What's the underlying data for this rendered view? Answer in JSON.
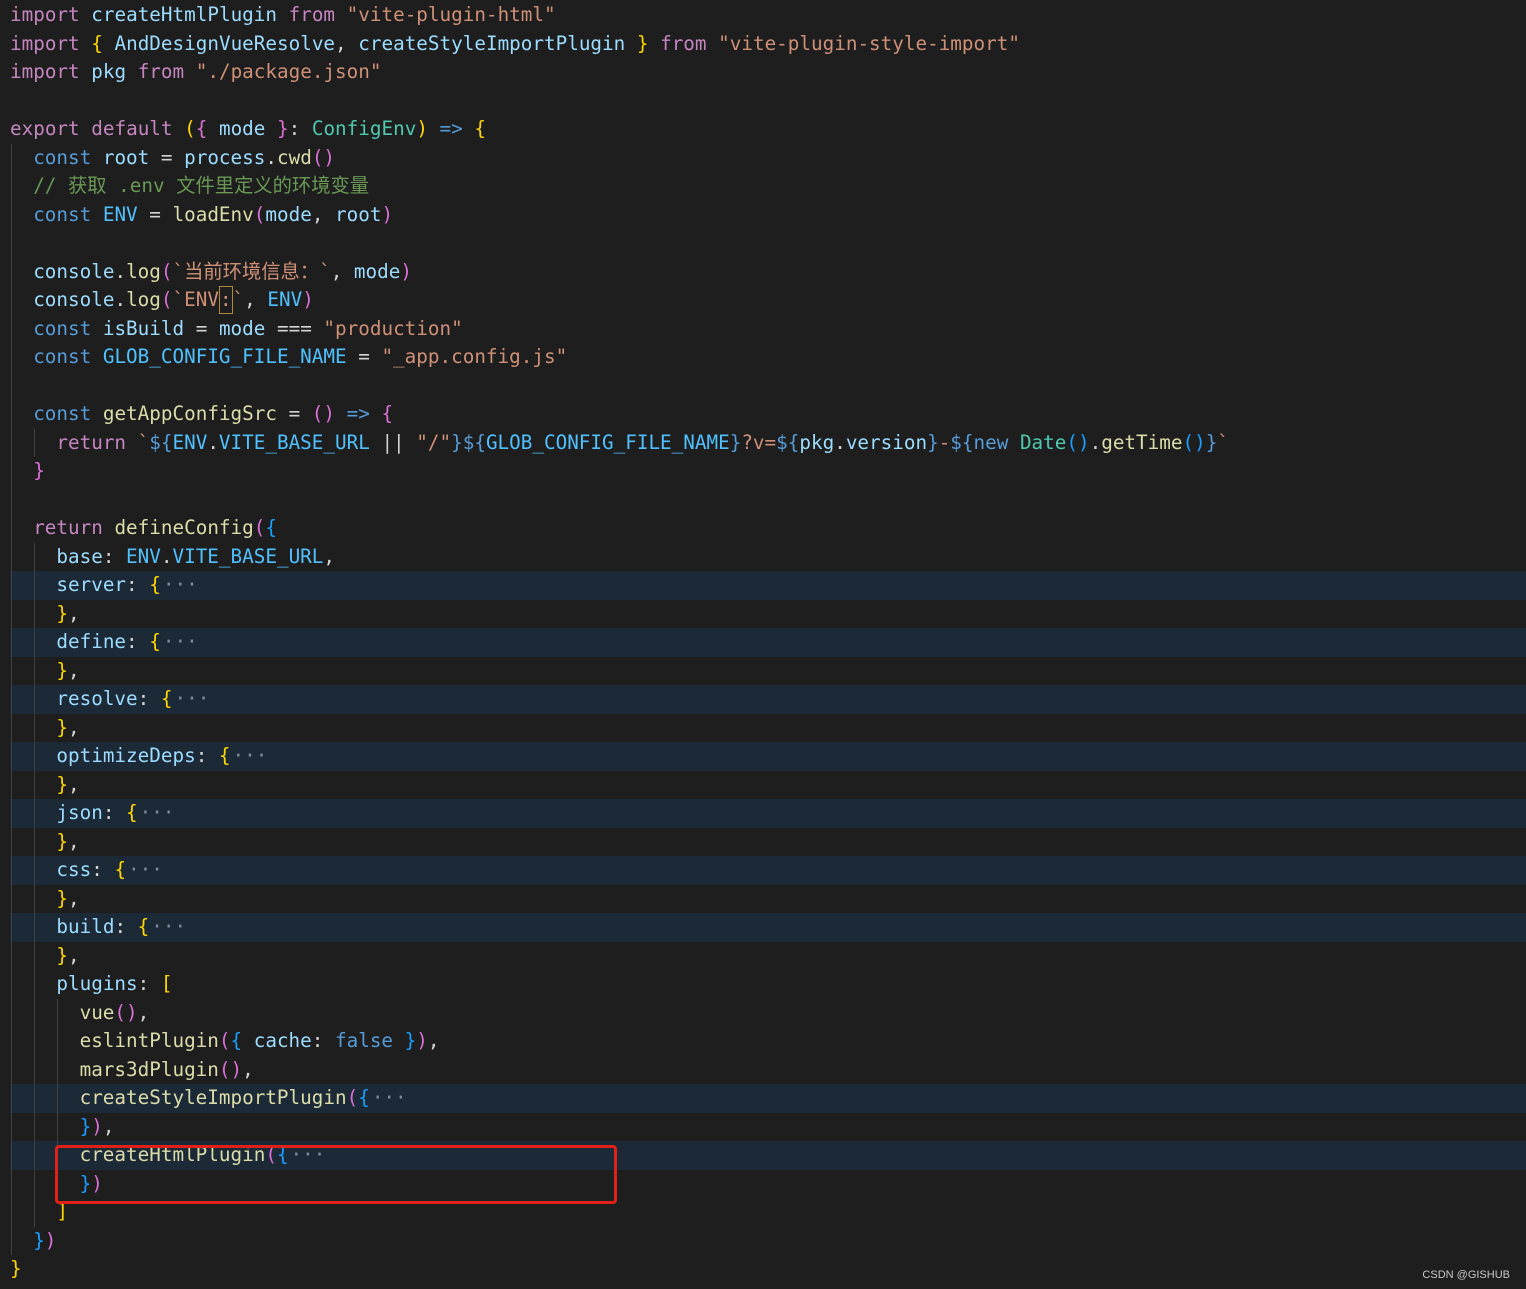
{
  "colors": {
    "background": "#1e1e1e",
    "folded_line_highlight": "#1c2a38",
    "indent_guide": "#404040",
    "keyword": "#c586c0",
    "storage": "#569cd6",
    "function": "#dcdcaa",
    "variable": "#9cdcfe",
    "constant": "#4fc1ff",
    "string": "#ce9178",
    "type": "#4ec9b0",
    "comment": "#6a9955",
    "bracket_level_1": "#ffd700",
    "bracket_level_2": "#da70d6",
    "bracket_level_3": "#179fff",
    "annotation_box": "#e0211a"
  },
  "watermark": "CSDN @GISHUB",
  "lines": [
    {
      "indent": 0,
      "tokens": [
        [
          "kw",
          "import"
        ],
        [
          "p",
          " "
        ],
        [
          "var",
          "createHtmlPlugin"
        ],
        [
          "p",
          " "
        ],
        [
          "kw",
          "from"
        ],
        [
          "p",
          " "
        ],
        [
          "str",
          "\"vite-plugin-html\""
        ]
      ]
    },
    {
      "indent": 0,
      "tokens": [
        [
          "kw",
          "import"
        ],
        [
          "p",
          " "
        ],
        [
          "b1",
          "{"
        ],
        [
          "p",
          " "
        ],
        [
          "var",
          "AndDesignVueResolve"
        ],
        [
          "p",
          ", "
        ],
        [
          "var",
          "createStyleImportPlugin"
        ],
        [
          "p",
          " "
        ],
        [
          "b1",
          "}"
        ],
        [
          "p",
          " "
        ],
        [
          "kw",
          "from"
        ],
        [
          "p",
          " "
        ],
        [
          "str",
          "\"vite-plugin-style-import\""
        ]
      ]
    },
    {
      "indent": 0,
      "tokens": [
        [
          "kw",
          "import"
        ],
        [
          "p",
          " "
        ],
        [
          "var",
          "pkg"
        ],
        [
          "p",
          " "
        ],
        [
          "kw",
          "from"
        ],
        [
          "p",
          " "
        ],
        [
          "str",
          "\"./package.json\""
        ]
      ]
    },
    {
      "indent": 0,
      "tokens": []
    },
    {
      "indent": 0,
      "tokens": [
        [
          "kw",
          "export"
        ],
        [
          "p",
          " "
        ],
        [
          "kw",
          "default"
        ],
        [
          "p",
          " "
        ],
        [
          "b1",
          "("
        ],
        [
          "b2",
          "{"
        ],
        [
          "p",
          " "
        ],
        [
          "var",
          "mode"
        ],
        [
          "p",
          " "
        ],
        [
          "b2",
          "}"
        ],
        [
          "p",
          ": "
        ],
        [
          "ty",
          "ConfigEnv"
        ],
        [
          "b1",
          ")"
        ],
        [
          "p",
          " "
        ],
        [
          "st",
          "=>"
        ],
        [
          "p",
          " "
        ],
        [
          "b1",
          "{"
        ]
      ]
    },
    {
      "indent": 1,
      "tokens": [
        [
          "st",
          "const"
        ],
        [
          "p",
          " "
        ],
        [
          "var",
          "root"
        ],
        [
          "p",
          " = "
        ],
        [
          "var",
          "process"
        ],
        [
          "p",
          "."
        ],
        [
          "fn",
          "cwd"
        ],
        [
          "b2",
          "()"
        ]
      ]
    },
    {
      "indent": 1,
      "tokens": [
        [
          "cmt",
          "// 获取 .env 文件里定义的环境变量"
        ]
      ]
    },
    {
      "indent": 1,
      "tokens": [
        [
          "st",
          "const"
        ],
        [
          "p",
          " "
        ],
        [
          "cst",
          "ENV"
        ],
        [
          "p",
          " = "
        ],
        [
          "fn",
          "loadEnv"
        ],
        [
          "b2",
          "("
        ],
        [
          "var",
          "mode"
        ],
        [
          "p",
          ", "
        ],
        [
          "var",
          "root"
        ],
        [
          "b2",
          ")"
        ]
      ]
    },
    {
      "indent": 1,
      "tokens": []
    },
    {
      "indent": 1,
      "tokens": [
        [
          "var",
          "console"
        ],
        [
          "p",
          "."
        ],
        [
          "fn",
          "log"
        ],
        [
          "b2",
          "("
        ],
        [
          "str",
          "`当前环境信息：`"
        ],
        [
          "p",
          ", "
        ],
        [
          "var",
          "mode"
        ],
        [
          "b2",
          ")"
        ]
      ]
    },
    {
      "indent": 1,
      "cursor": true,
      "tokens": [
        [
          "var",
          "console"
        ],
        [
          "p",
          "."
        ],
        [
          "fn",
          "log"
        ],
        [
          "b2",
          "("
        ],
        [
          "str",
          "`ENV"
        ],
        [
          "cursor",
          ":"
        ],
        [
          "str",
          "`"
        ],
        [
          "p",
          ", "
        ],
        [
          "cst",
          "ENV"
        ],
        [
          "b2",
          ")"
        ]
      ]
    },
    {
      "indent": 1,
      "tokens": [
        [
          "st",
          "const"
        ],
        [
          "p",
          " "
        ],
        [
          "var",
          "isBuild"
        ],
        [
          "p",
          " = "
        ],
        [
          "var",
          "mode"
        ],
        [
          "p",
          " === "
        ],
        [
          "str",
          "\"production\""
        ]
      ]
    },
    {
      "indent": 1,
      "tokens": [
        [
          "st",
          "const"
        ],
        [
          "p",
          " "
        ],
        [
          "cst",
          "GLOB_CONFIG_FILE_NAME"
        ],
        [
          "p",
          " = "
        ],
        [
          "str",
          "\"_app.config.js\""
        ]
      ]
    },
    {
      "indent": 1,
      "tokens": []
    },
    {
      "indent": 1,
      "tokens": [
        [
          "st",
          "const"
        ],
        [
          "p",
          " "
        ],
        [
          "fn",
          "getAppConfigSrc"
        ],
        [
          "p",
          " = "
        ],
        [
          "b2",
          "()"
        ],
        [
          "p",
          " "
        ],
        [
          "st",
          "=>"
        ],
        [
          "p",
          " "
        ],
        [
          "b2",
          "{"
        ]
      ]
    },
    {
      "indent": 2,
      "tokens": [
        [
          "kw",
          "return"
        ],
        [
          "p",
          " "
        ],
        [
          "str",
          "`"
        ],
        [
          "st",
          "${"
        ],
        [
          "cst",
          "ENV"
        ],
        [
          "p",
          "."
        ],
        [
          "cst",
          "VITE_BASE_URL"
        ],
        [
          "p",
          " || "
        ],
        [
          "str",
          "\"/\""
        ],
        [
          "st",
          "}${"
        ],
        [
          "cst",
          "GLOB_CONFIG_FILE_NAME"
        ],
        [
          "st",
          "}"
        ],
        [
          "str",
          "?v="
        ],
        [
          "st",
          "${"
        ],
        [
          "var",
          "pkg"
        ],
        [
          "p",
          "."
        ],
        [
          "var",
          "version"
        ],
        [
          "st",
          "}"
        ],
        [
          "str",
          "-"
        ],
        [
          "st",
          "${"
        ],
        [
          "st",
          "new"
        ],
        [
          "p",
          " "
        ],
        [
          "ty",
          "Date"
        ],
        [
          "b3",
          "()"
        ],
        [
          "p",
          "."
        ],
        [
          "fn",
          "getTime"
        ],
        [
          "b3",
          "()"
        ],
        [
          "st",
          "}"
        ],
        [
          "str",
          "`"
        ]
      ]
    },
    {
      "indent": 1,
      "tokens": [
        [
          "b2",
          "}"
        ]
      ]
    },
    {
      "indent": 1,
      "tokens": []
    },
    {
      "indent": 1,
      "tokens": [
        [
          "kw",
          "return"
        ],
        [
          "p",
          " "
        ],
        [
          "fn",
          "defineConfig"
        ],
        [
          "b2",
          "("
        ],
        [
          "b3",
          "{"
        ]
      ]
    },
    {
      "indent": 2,
      "tokens": [
        [
          "var",
          "base"
        ],
        [
          "p",
          ": "
        ],
        [
          "cst",
          "ENV"
        ],
        [
          "p",
          "."
        ],
        [
          "cst",
          "VITE_BASE_URL"
        ],
        [
          "p",
          ","
        ]
      ]
    },
    {
      "indent": 2,
      "folded": true,
      "tokens": [
        [
          "var",
          "server"
        ],
        [
          "p",
          ": "
        ],
        [
          "b1",
          "{"
        ],
        [
          "fold",
          "···"
        ]
      ]
    },
    {
      "indent": 2,
      "tokens": [
        [
          "b1",
          "}"
        ],
        [
          "p",
          ","
        ]
      ]
    },
    {
      "indent": 2,
      "folded": true,
      "tokens": [
        [
          "var",
          "define"
        ],
        [
          "p",
          ": "
        ],
        [
          "b1",
          "{"
        ],
        [
          "fold",
          "···"
        ]
      ]
    },
    {
      "indent": 2,
      "tokens": [
        [
          "b1",
          "}"
        ],
        [
          "p",
          ","
        ]
      ]
    },
    {
      "indent": 2,
      "folded": true,
      "tokens": [
        [
          "var",
          "resolve"
        ],
        [
          "p",
          ": "
        ],
        [
          "b1",
          "{"
        ],
        [
          "fold",
          "···"
        ]
      ]
    },
    {
      "indent": 2,
      "tokens": [
        [
          "b1",
          "}"
        ],
        [
          "p",
          ","
        ]
      ]
    },
    {
      "indent": 2,
      "folded": true,
      "tokens": [
        [
          "var",
          "optimizeDeps"
        ],
        [
          "p",
          ": "
        ],
        [
          "b1",
          "{"
        ],
        [
          "fold",
          "···"
        ]
      ]
    },
    {
      "indent": 2,
      "tokens": [
        [
          "b1",
          "}"
        ],
        [
          "p",
          ","
        ]
      ]
    },
    {
      "indent": 2,
      "folded": true,
      "tokens": [
        [
          "var",
          "json"
        ],
        [
          "p",
          ": "
        ],
        [
          "b1",
          "{"
        ],
        [
          "fold",
          "···"
        ]
      ]
    },
    {
      "indent": 2,
      "tokens": [
        [
          "b1",
          "}"
        ],
        [
          "p",
          ","
        ]
      ]
    },
    {
      "indent": 2,
      "folded": true,
      "tokens": [
        [
          "var",
          "css"
        ],
        [
          "p",
          ": "
        ],
        [
          "b1",
          "{"
        ],
        [
          "fold",
          "···"
        ]
      ]
    },
    {
      "indent": 2,
      "tokens": [
        [
          "b1",
          "}"
        ],
        [
          "p",
          ","
        ]
      ]
    },
    {
      "indent": 2,
      "folded": true,
      "tokens": [
        [
          "var",
          "build"
        ],
        [
          "p",
          ": "
        ],
        [
          "b1",
          "{"
        ],
        [
          "fold",
          "···"
        ]
      ]
    },
    {
      "indent": 2,
      "tokens": [
        [
          "b1",
          "}"
        ],
        [
          "p",
          ","
        ]
      ]
    },
    {
      "indent": 2,
      "tokens": [
        [
          "var",
          "plugins"
        ],
        [
          "p",
          ": "
        ],
        [
          "b1",
          "["
        ]
      ]
    },
    {
      "indent": 3,
      "tokens": [
        [
          "fn",
          "vue"
        ],
        [
          "b2",
          "()"
        ],
        [
          "p",
          ","
        ]
      ]
    },
    {
      "indent": 3,
      "tokens": [
        [
          "fn",
          "eslintPlugin"
        ],
        [
          "b2",
          "("
        ],
        [
          "b3",
          "{"
        ],
        [
          "p",
          " "
        ],
        [
          "var",
          "cache"
        ],
        [
          "p",
          ": "
        ],
        [
          "st",
          "false"
        ],
        [
          "p",
          " "
        ],
        [
          "b3",
          "}"
        ],
        [
          "b2",
          ")"
        ],
        [
          "p",
          ","
        ]
      ]
    },
    {
      "indent": 3,
      "tokens": [
        [
          "fn",
          "mars3dPlugin"
        ],
        [
          "b2",
          "()"
        ],
        [
          "p",
          ","
        ]
      ]
    },
    {
      "indent": 3,
      "folded": true,
      "tokens": [
        [
          "fn",
          "createStyleImportPlugin"
        ],
        [
          "b2",
          "("
        ],
        [
          "b3",
          "{"
        ],
        [
          "fold",
          "···"
        ]
      ]
    },
    {
      "indent": 3,
      "tokens": [
        [
          "b3",
          "}"
        ],
        [
          "b2",
          ")"
        ],
        [
          "p",
          ","
        ]
      ]
    },
    {
      "indent": 3,
      "folded": true,
      "tokens": [
        [
          "fn",
          "createHtmlPlugin"
        ],
        [
          "b2",
          "("
        ],
        [
          "b3",
          "{"
        ],
        [
          "fold",
          "···"
        ]
      ]
    },
    {
      "indent": 3,
      "tokens": [
        [
          "b3",
          "}"
        ],
        [
          "b2",
          ")"
        ]
      ]
    },
    {
      "indent": 2,
      "tokens": [
        [
          "b1",
          "]"
        ]
      ]
    },
    {
      "indent": 1,
      "tokens": [
        [
          "b3",
          "}"
        ],
        [
          "b2",
          ")"
        ]
      ]
    },
    {
      "indent": 0,
      "tokens": [
        [
          "b1",
          "}"
        ]
      ]
    }
  ]
}
